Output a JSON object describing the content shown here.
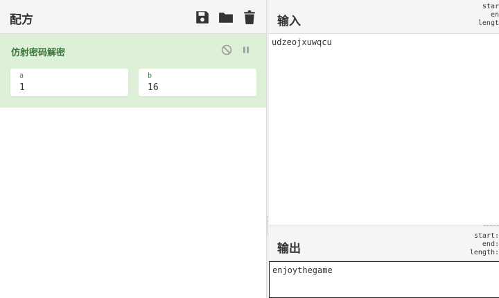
{
  "recipe": {
    "title": "配方",
    "operation": {
      "title": "仿射密码解密",
      "args": [
        {
          "label": "a",
          "value": "1"
        },
        {
          "label": "b",
          "value": "16"
        }
      ]
    }
  },
  "input": {
    "title": "输入",
    "stats": {
      "start": "star",
      "end": "en",
      "length": "lengt"
    },
    "text": "udzeojxuwqcu"
  },
  "output": {
    "title": "输出",
    "stats": {
      "start": "start:",
      "end": "end:",
      "length": "length:"
    },
    "text": "enjoythegame"
  },
  "colors": {
    "operation_bg": "#dff0d8",
    "operation_text": "#3c763d",
    "header_bg": "#f5f5f5"
  }
}
